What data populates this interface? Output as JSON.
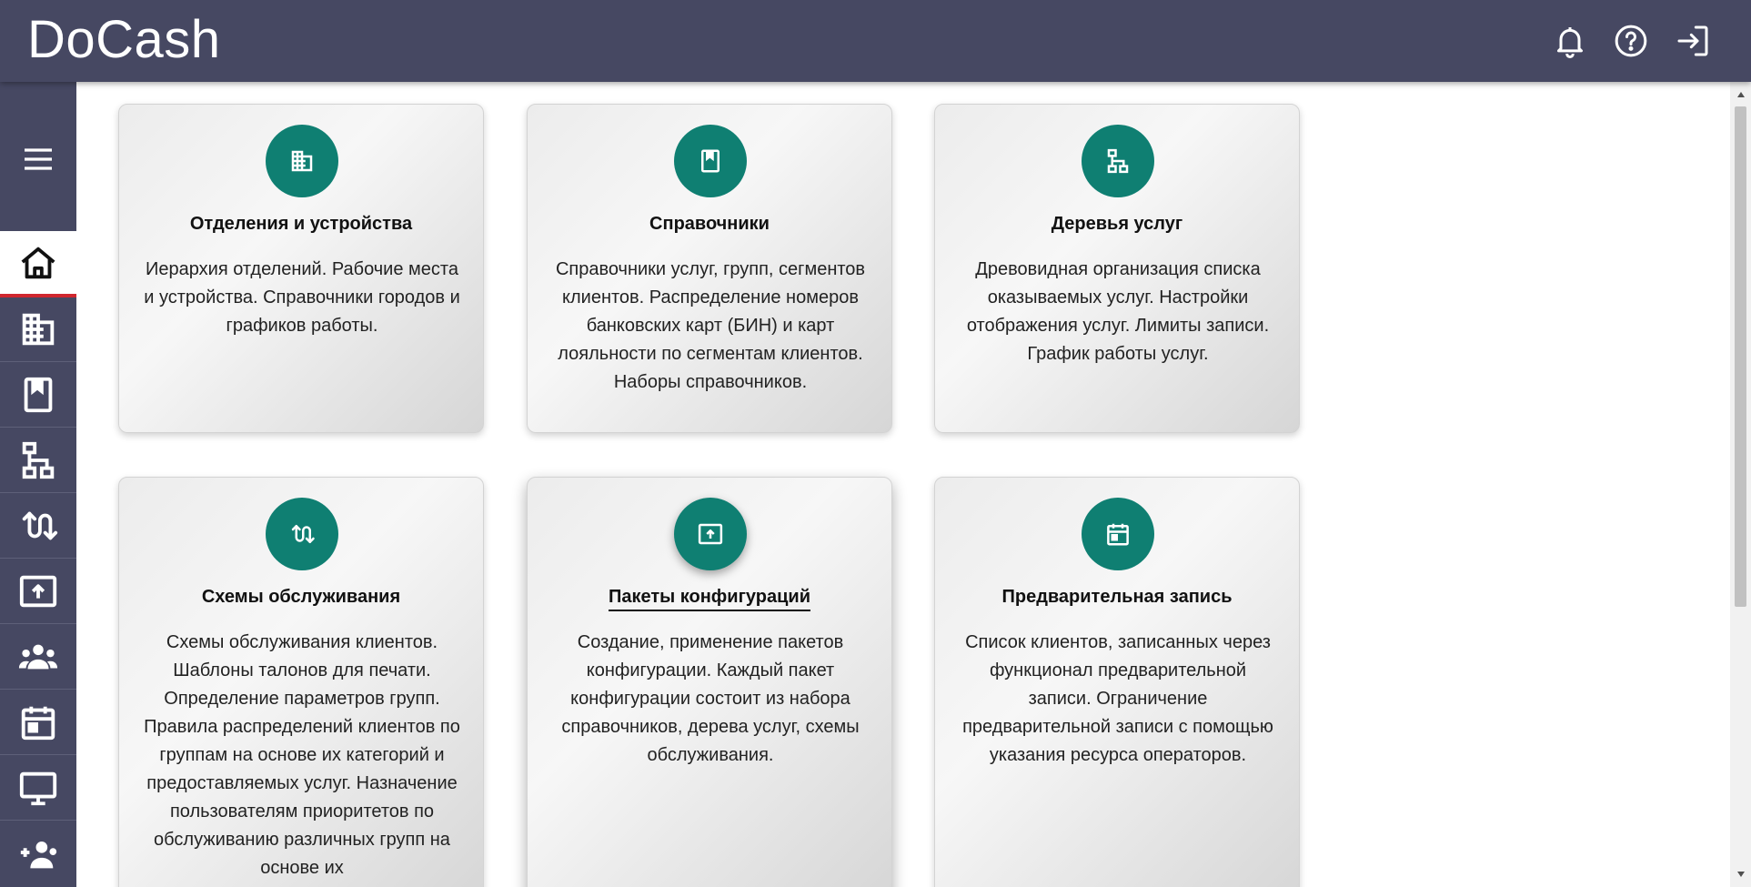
{
  "app": {
    "title": "DoCash"
  },
  "header": {
    "icons": [
      "bell-icon",
      "help-icon",
      "logout-icon"
    ]
  },
  "sidebar": {
    "menu_icon": "hamburger-menu-icon",
    "items": [
      {
        "icon": "home-icon",
        "active": true
      },
      {
        "icon": "building-icon",
        "active": false
      },
      {
        "icon": "book-icon",
        "active": false
      },
      {
        "icon": "tree-structure-icon",
        "active": false
      },
      {
        "icon": "swap-arrows-icon",
        "active": false
      },
      {
        "icon": "upload-box-icon",
        "active": false
      },
      {
        "icon": "group-icon",
        "active": false
      },
      {
        "icon": "calendar-icon",
        "active": false
      },
      {
        "icon": "monitor-icon",
        "active": false
      },
      {
        "icon": "add-user-icon",
        "active": false
      }
    ]
  },
  "cards": [
    {
      "icon": "building-icon",
      "title": "Отделения и устройства",
      "description": "Иерархия отделений. Рабочие места и устройства. Справочники городов и графиков работы."
    },
    {
      "icon": "book-icon",
      "title": "Справочники",
      "description": "Справочники услуг, групп, сегментов клиентов. Распределение номеров банковских карт (БИН) и карт лояльности по сегментам клиентов. Наборы справочников."
    },
    {
      "icon": "tree-structure-icon",
      "title": "Деревья услуг",
      "description": "Древовидная организация списка оказываемых услуг. Настройки отображения услуг. Лимиты записи. График работы услуг."
    },
    {
      "icon": "swap-arrows-icon",
      "title": "Схемы обслуживания",
      "description": "Схемы обслуживания клиентов. Шаблоны талонов для печати. Определение параметров групп. Правила распределений клиентов по группам на основе их категорий и предоставляемых услуг. Назначение пользователям приоритетов по обслуживанию различных групп на основе их"
    },
    {
      "icon": "upload-box-icon",
      "title": "Пакеты конфигураций",
      "description": "Создание, применение пакетов конфигурации. Каждый пакет конфигурации состоит из набора справочников, дерева услуг, схемы обслуживания."
    },
    {
      "icon": "calendar-icon",
      "title": "Предварительная запись",
      "description": "Список клиентов, записанных через функционал предварительной записи. Ограничение предварительной записи с помощью указания ресурса операторов."
    }
  ],
  "colors": {
    "header_bg": "#464862",
    "accent_teal": "#0f7f72",
    "active_indicator": "#d0262e"
  }
}
